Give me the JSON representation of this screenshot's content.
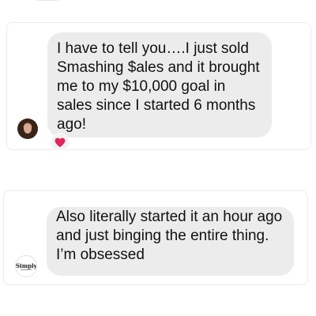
{
  "messages": [
    {
      "text": "I have to tell you….I just sold Smashing $ales and it brought me to my $10,000 goal in sales since I started 6 months ago!",
      "reaction_icon": "heart-icon",
      "reaction_color": "#e0245e"
    },
    {
      "text": "Also literally started it an hour ago and just binging the entire thing. I’m obsessed",
      "avatar_logo": "Simply."
    }
  ],
  "colors": {
    "bubble_bg": "#ececec",
    "text": "#111111"
  }
}
